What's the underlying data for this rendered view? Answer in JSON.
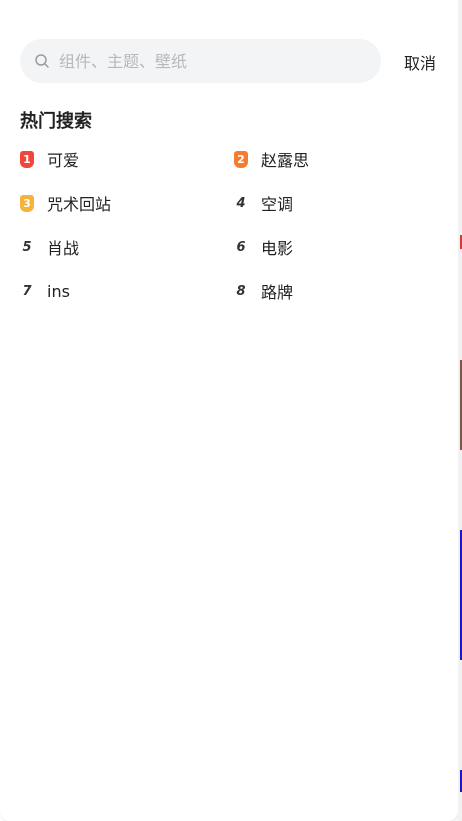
{
  "search": {
    "placeholder": "组件、主题、壁纸",
    "cancel_label": "取消"
  },
  "hot": {
    "title": "热门搜索",
    "items": [
      {
        "rank": "1",
        "text": "可爱",
        "badge_color": "#f2453d"
      },
      {
        "rank": "2",
        "text": "赵露思",
        "badge_color": "#f57c2e"
      },
      {
        "rank": "3",
        "text": "咒术回站",
        "badge_color": "#f7b23b"
      },
      {
        "rank": "4",
        "text": "空调"
      },
      {
        "rank": "5",
        "text": "肖战"
      },
      {
        "rank": "6",
        "text": "电影"
      },
      {
        "rank": "7",
        "text": "ins"
      },
      {
        "rank": "8",
        "text": "路牌"
      }
    ]
  }
}
